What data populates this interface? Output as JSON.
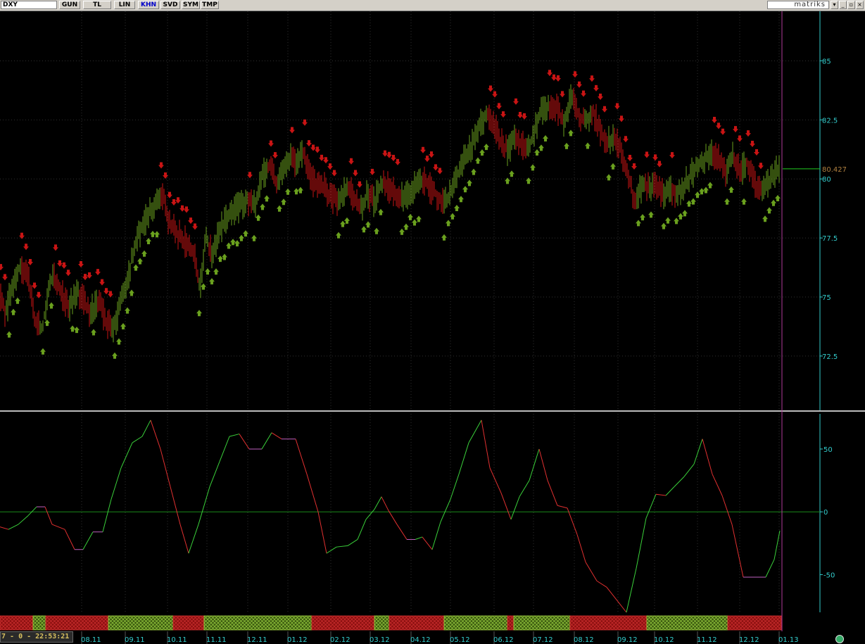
{
  "toolbar": {
    "symbol": "DXY",
    "buttons": [
      {
        "label": "GUN",
        "active": false
      },
      {
        "label": "TL",
        "active": false
      },
      {
        "label": "LIN",
        "active": false
      },
      {
        "label": "KHN",
        "active": true
      },
      {
        "label": "SVD",
        "active": false
      },
      {
        "label": "SYM",
        "active": false
      },
      {
        "label": "TMP",
        "active": false
      }
    ],
    "brand": "matriks"
  },
  "status": {
    "text": "7 - 0 - 22:53:21"
  },
  "colors": {
    "up": "#6aa01e",
    "down": "#c81414",
    "axis": "#33cccc",
    "grid": "#303030",
    "last_price_line": "#22cc22",
    "cursor_line": "#b03a9a",
    "zero_line": "#1a8a1a"
  },
  "chart_data": [
    {
      "type": "candlestick",
      "symbol": "DXY",
      "y_ticks": [
        "85",
        "82.5",
        "80",
        "77.5",
        "75",
        "72.5"
      ],
      "y_tick_values": [
        85,
        82.5,
        80,
        77.5,
        75,
        72.5
      ],
      "ylim": [
        70.2,
        87.1
      ],
      "last_price": "80.427",
      "last_price_value": 80.427,
      "path_points": [
        [
          0,
          75.0
        ],
        [
          8,
          74.3
        ],
        [
          18,
          75.5
        ],
        [
          28,
          76.3
        ],
        [
          40,
          75.8
        ],
        [
          50,
          74.0
        ],
        [
          60,
          73.6
        ],
        [
          68,
          75.3
        ],
        [
          76,
          76.0
        ],
        [
          86,
          75.2
        ],
        [
          98,
          74.6
        ],
        [
          112,
          75.2
        ],
        [
          126,
          74.4
        ],
        [
          140,
          74.8
        ],
        [
          152,
          73.9
        ],
        [
          162,
          73.7
        ],
        [
          172,
          74.8
        ],
        [
          182,
          75.8
        ],
        [
          192,
          77.3
        ],
        [
          202,
          78.0
        ],
        [
          212,
          78.6
        ],
        [
          222,
          79.0
        ],
        [
          232,
          79.4
        ],
        [
          238,
          78.3
        ],
        [
          248,
          77.8
        ],
        [
          258,
          77.5
        ],
        [
          268,
          77.2
        ],
        [
          278,
          76.6
        ],
        [
          284,
          75.3
        ],
        [
          292,
          77.5
        ],
        [
          302,
          76.8
        ],
        [
          312,
          77.8
        ],
        [
          322,
          78.3
        ],
        [
          332,
          78.6
        ],
        [
          342,
          78.9
        ],
        [
          352,
          79.1
        ],
        [
          362,
          78.9
        ],
        [
          372,
          80.1
        ],
        [
          382,
          80.6
        ],
        [
          392,
          79.8
        ],
        [
          402,
          80.3
        ],
        [
          412,
          80.9
        ],
        [
          422,
          80.7
        ],
        [
          432,
          81.2
        ],
        [
          442,
          79.9
        ],
        [
          452,
          79.8
        ],
        [
          462,
          79.6
        ],
        [
          472,
          79.2
        ],
        [
          482,
          79.0
        ],
        [
          492,
          79.6
        ],
        [
          502,
          79.3
        ],
        [
          512,
          78.6
        ],
        [
          522,
          79.4
        ],
        [
          532,
          79.0
        ],
        [
          542,
          79.9
        ],
        [
          552,
          79.6
        ],
        [
          562,
          79.4
        ],
        [
          572,
          79.2
        ],
        [
          582,
          79.5
        ],
        [
          592,
          79.7
        ],
        [
          602,
          79.9
        ],
        [
          612,
          79.6
        ],
        [
          622,
          79.3
        ],
        [
          632,
          78.9
        ],
        [
          642,
          79.6
        ],
        [
          652,
          80.3
        ],
        [
          662,
          81.0
        ],
        [
          672,
          81.5
        ],
        [
          682,
          82.3
        ],
        [
          692,
          82.7
        ],
        [
          702,
          82.3
        ],
        [
          712,
          81.5
        ],
        [
          722,
          81.2
        ],
        [
          732,
          81.9
        ],
        [
          742,
          81.4
        ],
        [
          752,
          81.3
        ],
        [
          762,
          82.3
        ],
        [
          772,
          83.0
        ],
        [
          782,
          83.1
        ],
        [
          792,
          82.9
        ],
        [
          802,
          82.3
        ],
        [
          812,
          83.5
        ],
        [
          822,
          82.7
        ],
        [
          832,
          82.4
        ],
        [
          842,
          82.9
        ],
        [
          852,
          82.1
        ],
        [
          862,
          81.4
        ],
        [
          872,
          81.9
        ],
        [
          882,
          81.3
        ],
        [
          892,
          80.1
        ],
        [
          902,
          79.1
        ],
        [
          912,
          79.7
        ],
        [
          922,
          79.6
        ],
        [
          932,
          79.7
        ],
        [
          942,
          79.3
        ],
        [
          952,
          79.6
        ],
        [
          962,
          79.4
        ],
        [
          972,
          79.7
        ],
        [
          982,
          80.2
        ],
        [
          992,
          80.6
        ],
        [
          1002,
          80.9
        ],
        [
          1012,
          81.1
        ],
        [
          1022,
          80.9
        ],
        [
          1032,
          80.3
        ],
        [
          1042,
          81.0
        ],
        [
          1052,
          80.3
        ],
        [
          1062,
          80.7
        ],
        [
          1072,
          79.9
        ],
        [
          1082,
          79.4
        ],
        [
          1092,
          79.8
        ],
        [
          1102,
          80.3
        ],
        [
          1108,
          80.4
        ]
      ]
    },
    {
      "type": "line",
      "y_ticks": [
        "50",
        "0",
        "-50"
      ],
      "y_tick_values": [
        50,
        0,
        -50
      ],
      "ylim": [
        -80,
        78
      ],
      "points": [
        [
          0,
          -12
        ],
        [
          12,
          -14
        ],
        [
          26,
          -10
        ],
        [
          40,
          -3
        ],
        [
          52,
          4
        ],
        [
          64,
          4
        ],
        [
          74,
          -10
        ],
        [
          92,
          -14
        ],
        [
          106,
          -30
        ],
        [
          118,
          -30
        ],
        [
          132,
          -16
        ],
        [
          146,
          -16
        ],
        [
          158,
          10
        ],
        [
          172,
          35
        ],
        [
          188,
          55
        ],
        [
          202,
          60
        ],
        [
          214,
          73
        ],
        [
          228,
          50
        ],
        [
          242,
          20
        ],
        [
          256,
          -10
        ],
        [
          268,
          -33
        ],
        [
          282,
          -10
        ],
        [
          298,
          20
        ],
        [
          312,
          40
        ],
        [
          326,
          60
        ],
        [
          340,
          62
        ],
        [
          354,
          50
        ],
        [
          372,
          50
        ],
        [
          386,
          63
        ],
        [
          400,
          58
        ],
        [
          420,
          58
        ],
        [
          436,
          30
        ],
        [
          452,
          0
        ],
        [
          464,
          -33
        ],
        [
          478,
          -28
        ],
        [
          494,
          -27
        ],
        [
          508,
          -22
        ],
        [
          520,
          -6
        ],
        [
          532,
          2
        ],
        [
          542,
          12
        ],
        [
          552,
          1
        ],
        [
          564,
          -10
        ],
        [
          578,
          -22
        ],
        [
          590,
          -22
        ],
        [
          600,
          -20
        ],
        [
          614,
          -30
        ],
        [
          626,
          -8
        ],
        [
          640,
          10
        ],
        [
          652,
          30
        ],
        [
          666,
          55
        ],
        [
          684,
          73
        ],
        [
          696,
          35
        ],
        [
          712,
          15
        ],
        [
          726,
          -6
        ],
        [
          738,
          12
        ],
        [
          752,
          25
        ],
        [
          766,
          50
        ],
        [
          778,
          25
        ],
        [
          792,
          5
        ],
        [
          806,
          3
        ],
        [
          820,
          -18
        ],
        [
          832,
          -40
        ],
        [
          848,
          -55
        ],
        [
          862,
          -60
        ],
        [
          876,
          -70
        ],
        [
          890,
          -80
        ],
        [
          904,
          -45
        ],
        [
          918,
          -5
        ],
        [
          932,
          14
        ],
        [
          946,
          13
        ],
        [
          958,
          20
        ],
        [
          972,
          28
        ],
        [
          986,
          38
        ],
        [
          998,
          58
        ],
        [
          1012,
          30
        ],
        [
          1026,
          13
        ],
        [
          1040,
          -10
        ],
        [
          1056,
          -52
        ],
        [
          1072,
          -52
        ],
        [
          1088,
          -52
        ],
        [
          1100,
          -38
        ],
        [
          1108,
          -15
        ]
      ]
    },
    {
      "type": "x_axis",
      "x_labels": [
        "08.11",
        "09.11",
        "10.11",
        "11.11",
        "12.11",
        "01.12",
        "02.12",
        "03.12",
        "04.12",
        "05.12",
        "06.12",
        "07.12",
        "08.12",
        "09.12",
        "10.12",
        "11.12",
        "12.12",
        "01.13"
      ],
      "signal_band": [
        {
          "state": "down"
        },
        {
          "state": "up"
        },
        {
          "state": "down"
        },
        {
          "state": "up"
        },
        {
          "state": "down"
        },
        {
          "state": "up"
        },
        {
          "state": "down"
        },
        {
          "state": "up"
        },
        {
          "state": "down"
        },
        {
          "state": "up"
        },
        {
          "state": "down"
        },
        {
          "state": "up"
        },
        {
          "state": "down"
        },
        {
          "state": "up"
        },
        {
          "state": "down"
        },
        {
          "state": "up"
        },
        {
          "state": "down"
        }
      ]
    }
  ]
}
